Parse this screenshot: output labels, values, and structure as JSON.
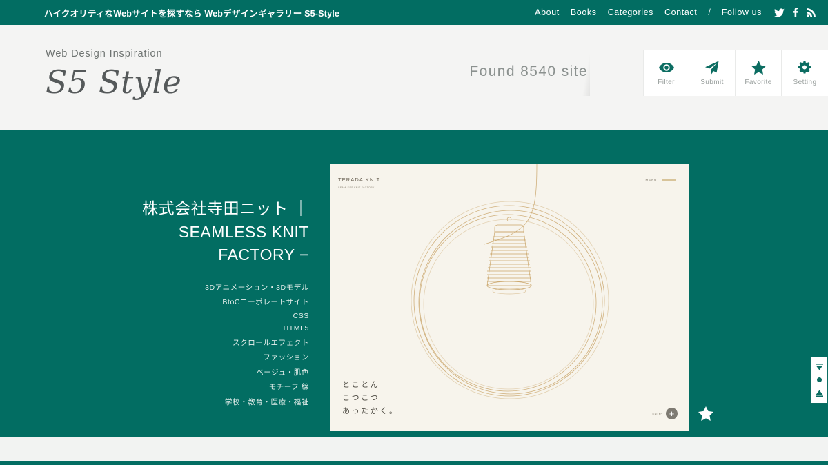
{
  "topbar": {
    "tagline": "ハイクオリティなWebサイトを探すなら Webデザインギャラリー S5-Style",
    "nav": [
      {
        "label": "About"
      },
      {
        "label": "Books"
      },
      {
        "label": "Categories"
      },
      {
        "label": "Contact"
      }
    ],
    "separator": "/",
    "follow_label": "Follow us",
    "social": [
      {
        "name": "twitter-icon"
      },
      {
        "name": "facebook-icon"
      },
      {
        "name": "rss-icon"
      }
    ],
    "bg_color": "#026d62"
  },
  "brand": {
    "subtitle": "Web Design Inspiration",
    "title": "S5 Style"
  },
  "counter": {
    "prefix": "Found",
    "count": "8540",
    "suffix": "site",
    "full": "Found 8540 site"
  },
  "toolbar": {
    "items": [
      {
        "label": "Filter",
        "icon": "eye-icon"
      },
      {
        "label": "Submit",
        "icon": "paper-plane-icon"
      },
      {
        "label": "Favorite",
        "icon": "star-icon"
      },
      {
        "label": "Setting",
        "icon": "gear-icon"
      }
    ],
    "accent_color": "#0c6d62"
  },
  "entry": {
    "title_lines": [
      "株式会社寺田ニット ｜",
      "SEAMLESS KNIT",
      "FACTORY −"
    ],
    "tags": [
      "3Dアニメーション・3Dモデル",
      "BtoCコーポレートサイト",
      "CSS",
      "HTML5",
      "スクロールエフェクト",
      "ファッション",
      "ベージュ・肌色",
      "モチーフ 線",
      "学校・教育・医療・福祉"
    ]
  },
  "preview": {
    "logo_name": "TERADA KNIT",
    "logo_tagline": "SEAMLESS KNIT\nFACTORY",
    "menu_label": "MENU",
    "copy_lines": [
      "とことん",
      "こつこつ",
      "あったかく。"
    ],
    "plus_label": "ENTRY",
    "plus_symbol": "+",
    "bg_color": "#f7f4ec",
    "line_color": "#c9a468"
  },
  "favorite": {
    "icon": "star-icon"
  },
  "scroller": {
    "up": "scroll-top-icon",
    "dot": "scroll-dot-icon",
    "down": "scroll-bottom-icon"
  },
  "colors": {
    "teal": "#026d62",
    "page_bg": "#f2f3f2",
    "brand_band": "#f4f4f3"
  }
}
